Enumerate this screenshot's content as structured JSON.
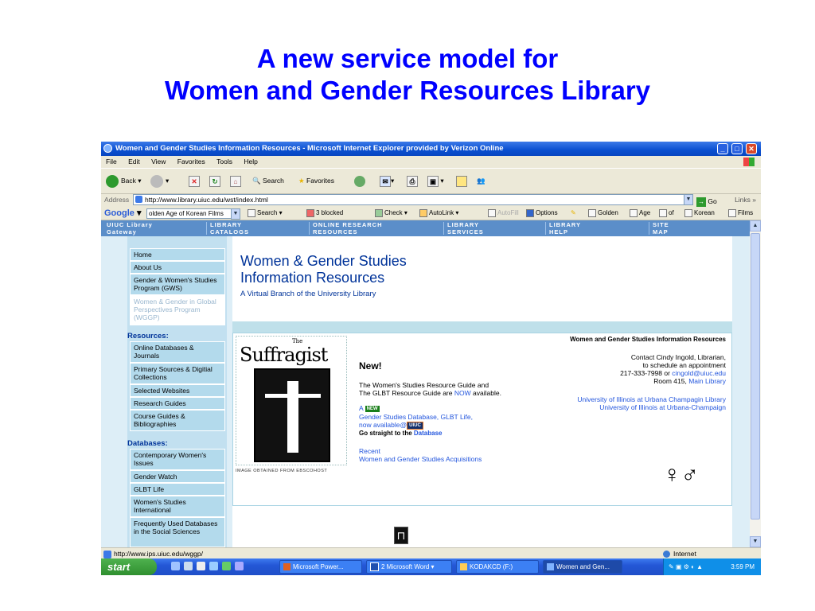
{
  "slide": {
    "title_line1": "A new service model for",
    "title_line2": "Women and Gender Resources Library"
  },
  "window": {
    "title": "Women and Gender Studies Information Resources - Microsoft Internet Explorer provided by Verizon Online",
    "min": "_",
    "max": "□",
    "close": "✕"
  },
  "menu": [
    "File",
    "Edit",
    "View",
    "Favorites",
    "Tools",
    "Help"
  ],
  "toolbar": {
    "back": "Back",
    "search": "Search",
    "favorites": "Favorites"
  },
  "address": {
    "label": "Address",
    "url": "http://www.library.uiuc.edu/wst/index.html",
    "go": "Go",
    "links": "Links"
  },
  "google_bar": {
    "logo": "Google",
    "query": "olden Age of Korean Films",
    "search": "Search",
    "blocked": "3 blocked",
    "check": "Check",
    "autolink": "AutoLink",
    "autofill": "AutoFill",
    "options": "Options",
    "words": [
      "Golden",
      "Age",
      "of",
      "Korean",
      "Films"
    ]
  },
  "site_nav": [
    {
      "line1": "UIUC Library",
      "line2": "Gateway"
    },
    {
      "line1": "LIBRARY",
      "line2": "CATALOGS"
    },
    {
      "line1": "ONLINE RESEARCH",
      "line2": "RESOURCES"
    },
    {
      "line1": "LIBRARY",
      "line2": "SERVICES"
    },
    {
      "line1": "LIBRARY",
      "line2": "HELP"
    },
    {
      "line1": "SITE",
      "line2": "MAP"
    }
  ],
  "sidebar": {
    "top": [
      "Home",
      "About Us",
      "Gender & Women's Studies Program (GWS)",
      "Women & Gender in Global Perspectives Program (WGGP)"
    ],
    "resources_head": "Resources:",
    "resources": [
      "Online Databases & Journals",
      "Primary Sources & Digitial Collections",
      "Selected Websites",
      "Research Guides",
      "Course Guides & Bibliographies"
    ],
    "databases_head": "Databases:",
    "databases": [
      "Contemporary Women's Issues",
      "Gender Watch",
      "GLBT Life",
      "Women's Studies International",
      "Frequently Used Databases in the Social Sciences"
    ]
  },
  "site": {
    "title": "Women & Gender Studies\nInformation Resources",
    "subtitle": "A Virtual Branch of the University Library"
  },
  "feature": {
    "cover_title": "Suffragist",
    "cover_the": "The",
    "cover_caption": "IMAGE OBTAINED FROM EBSCOHOST",
    "new_heading": "New!",
    "guide_line1": "The Women's Studies Resource Guide and",
    "guide_line2": "The GLBT Resource Guide are",
    "now": "NOW",
    "available": "available.",
    "a": "A",
    "new_badge": "NEW",
    "db_link": "Gender Studies Database, GLBT Life,",
    "now_available": "now available@",
    "uiuc_badge": "UIUC",
    "go_straight": "Go straight to the",
    "database": "Database",
    "recent": "Recent",
    "acquisitions": "Women and Gender Studies Acquisitions"
  },
  "contact": {
    "heading": "Women and Gender Studies Information Resources",
    "line1": "Contact Cindy Ingold, Librarian,",
    "line2": "to schedule an appointment",
    "phone": "217-333-7998 or",
    "email": "cingold@uiuc.edu",
    "room": "Room 415,",
    "main_library": "Main Library",
    "uiuc_library": "University of Illinois at Urbana Champagin Library",
    "uiuc": "University of Illinois at Urbana-Champaign",
    "symbols": "♀♂"
  },
  "status": {
    "url": "http://www.ips.uiuc.edu/wggp/",
    "zone": "Internet"
  },
  "taskbar": {
    "start": "start",
    "tasks": [
      "Microsoft Power...",
      "2 Microsoft Word",
      "KODAKCD (F:)",
      "Women and Gen..."
    ],
    "clock": "3:59 PM"
  },
  "colors": {
    "slide_title": "#0000ff",
    "nav": "#5b8ec9",
    "site_title": "#003399",
    "link": "#2255dd"
  }
}
